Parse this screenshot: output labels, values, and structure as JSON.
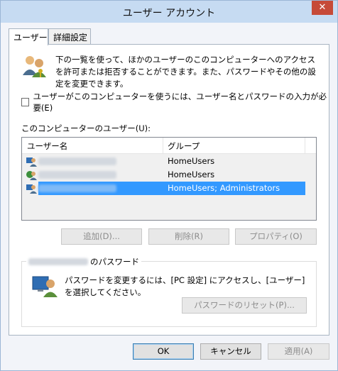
{
  "window": {
    "title": "ユーザー アカウント",
    "close_symbol": "✕"
  },
  "tabs": [
    {
      "label": "ユーザー"
    },
    {
      "label": "詳細設定"
    }
  ],
  "intro_text": "下の一覧を使って、ほかのユーザーのこのコンピューターへのアクセスを許可または拒否することができます。また、パスワードやその他の設定を変更できます。",
  "require_login": {
    "label": "ユーザーがこのコンピューターを使うには、ユーザー名とパスワードの入力が必要(E)",
    "checked": false
  },
  "users_section": {
    "label": "このコンピューターのユーザー(U):",
    "columns": {
      "name": "ユーザー名",
      "group": "グループ"
    },
    "rows": [
      {
        "group": "HomeUsers",
        "selected": false
      },
      {
        "group": "HomeUsers",
        "selected": false
      },
      {
        "group": "HomeUsers; Administrators",
        "selected": true
      }
    ]
  },
  "user_buttons": {
    "add": "追加(D)...",
    "remove": "削除(R)",
    "properties": "プロパティ(O)"
  },
  "password_group": {
    "legend_suffix": "のパスワード",
    "text": "パスワードを変更するには、[PC 設定] にアクセスし、[ユーザー] を選択してください。",
    "reset_button": "パスワードのリセット(P)..."
  },
  "dialog_buttons": {
    "ok": "OK",
    "cancel": "キャンセル",
    "apply": "適用(A)"
  },
  "colors": {
    "selection": "#3399ff",
    "titlebar": "#c6dbf2",
    "close": "#c64a38"
  }
}
